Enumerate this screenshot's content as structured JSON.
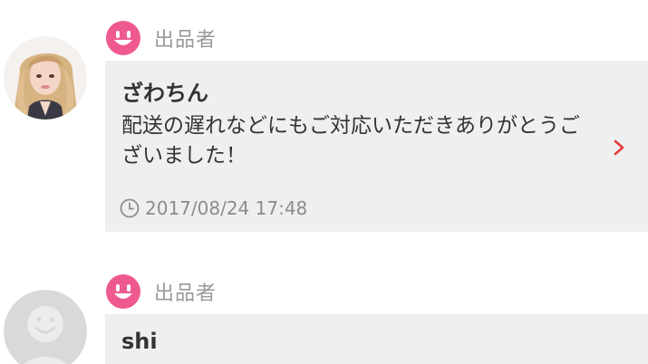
{
  "reviews": [
    {
      "role_label": "出品者",
      "user_name": "ざわちん",
      "comment": "配送の遅れなどにもご対応いただきありがとうございました！",
      "date": "2017/08/24 17:48",
      "avatar": "user-photo"
    },
    {
      "role_label": "出品者",
      "user_name": "shi",
      "avatar": "default-avatar-icon"
    }
  ],
  "colors": {
    "role_icon": "#ee5a8f",
    "card_background": "#efefef",
    "chevron": "#e23b3b",
    "muted_text": "#9a9a9a"
  }
}
